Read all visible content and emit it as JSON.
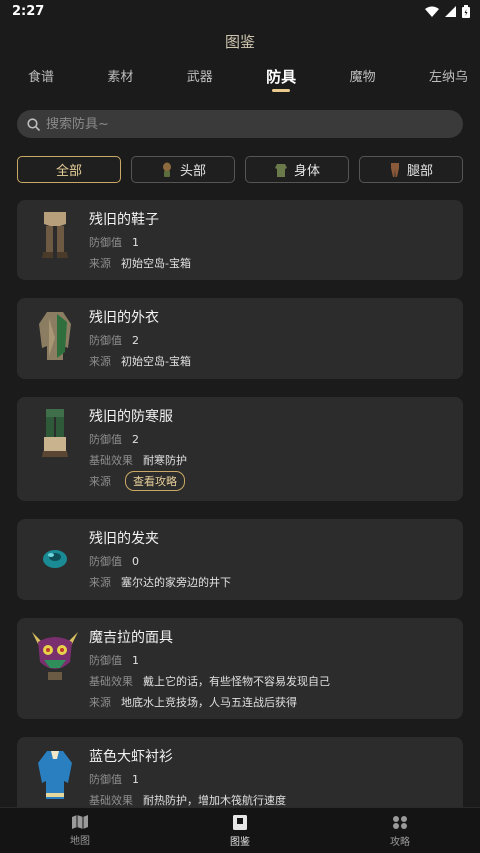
{
  "status": {
    "time": "2:27"
  },
  "page": {
    "title": "图鉴"
  },
  "tabs": [
    "食谱",
    "素材",
    "武器",
    "防具",
    "魔物",
    "左纳乌"
  ],
  "search": {
    "placeholder": "搜索防具~"
  },
  "filters": [
    "全部",
    "头部",
    "身体",
    "腿部"
  ],
  "labels": {
    "defense": "防御值",
    "effect": "基础效果",
    "source": "来源",
    "guide": "查看攻略"
  },
  "items": [
    {
      "name": "残旧的鞋子",
      "defense": "1",
      "source": "初始空岛-宝箱"
    },
    {
      "name": "残旧的外衣",
      "defense": "2",
      "source": "初始空岛-宝箱"
    },
    {
      "name": "残旧的防寒服",
      "defense": "2",
      "effect": "耐寒防护"
    },
    {
      "name": "残旧的发夹",
      "defense": "0",
      "source": "塞尔达的家旁边的井下"
    },
    {
      "name": "魔吉拉的面具",
      "defense": "1",
      "effect": "戴上它的话，有些怪物不容易发现自己",
      "source": "地底水上竞技场，人马五连战后获得"
    },
    {
      "name": "蓝色大虾衬衫",
      "defense": "1",
      "effect": "耐热防护，增加木筏航行速度"
    }
  ],
  "nav": [
    "地图",
    "图鉴",
    "攻略"
  ]
}
